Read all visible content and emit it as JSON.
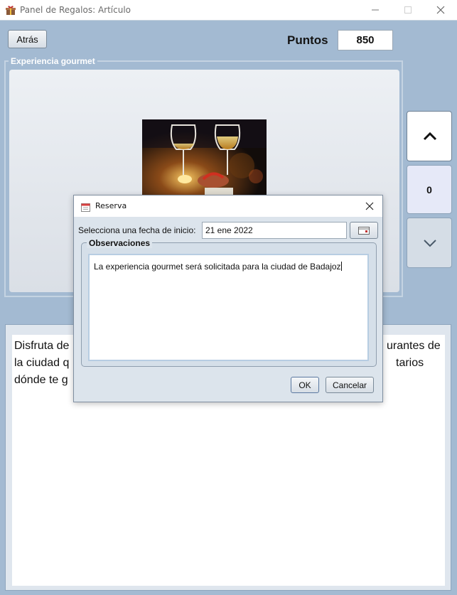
{
  "window": {
    "title": "Panel de Regalos: Artículo",
    "app_icon": "gift-icon",
    "controls": [
      "minimize-icon",
      "maximize-icon",
      "close-icon"
    ]
  },
  "header": {
    "back_button_label": "Atrás",
    "points_label": "Puntos",
    "points_value": "850"
  },
  "article": {
    "group_title": "Experiencia gourmet",
    "image": "wine-glasses-dinner-photo",
    "description_visible": [
      "Disfruta de",
      "urantes de",
      "la ciudad q",
      "tarios",
      "dónde te g"
    ]
  },
  "navigation": {
    "up_icon": "chevron-up-icon",
    "count": "0",
    "down_icon": "chevron-down-icon"
  },
  "dialog": {
    "title": "Reserva",
    "icon": "calendar-icon",
    "date_label": "Selecciona una fecha de inicio:",
    "date_value": "21 ene 2022",
    "calendar_button_icon": "calendar-picker-icon",
    "observations_title": "Observaciones",
    "observations_text": "La experiencia gourmet será solicitada para la ciudad de Badajoz",
    "ok_label": "OK",
    "cancel_label": "Cancelar"
  },
  "colors": {
    "background": "#a3bad2",
    "panel": "#dce4ec",
    "accent_border": "#b7cde2"
  }
}
